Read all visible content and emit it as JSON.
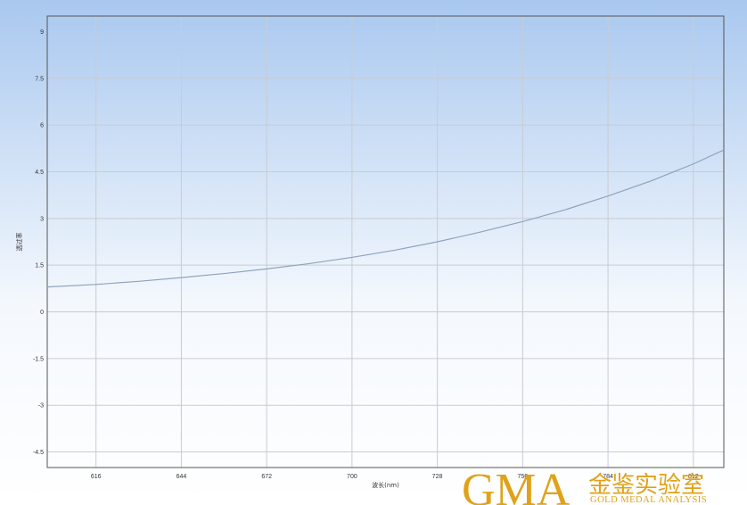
{
  "chart_data": {
    "type": "line",
    "title": "",
    "xlabel": "波长(nm)",
    "ylabel": "透过率",
    "xlim": [
      600,
      822
    ],
    "ylim": [
      -5,
      9.5
    ],
    "x_ticks": [
      "616",
      "644",
      "672",
      "700",
      "728",
      "756",
      "784",
      "812"
    ],
    "y_ticks": [
      "9",
      "7.5",
      "6",
      "4.5",
      "3",
      "1.5",
      "0",
      "-1.5",
      "-3",
      "-4.5"
    ],
    "grid": true,
    "series": [
      {
        "x": [
          600,
          616,
          630,
          644,
          658,
          672,
          686,
          700,
          714,
          728,
          742,
          756,
          770,
          784,
          798,
          812,
          822
        ],
        "y": [
          0.8,
          0.88,
          0.98,
          1.1,
          1.23,
          1.38,
          1.55,
          1.75,
          1.98,
          2.25,
          2.56,
          2.9,
          3.28,
          3.72,
          4.2,
          4.75,
          5.2
        ],
        "color": "#8fa3bd"
      }
    ]
  },
  "watermark": {
    "logo_text": "GMA",
    "chinese_text": "金鉴实验室",
    "english_text": "GOLD MEDAL ANALYSIS",
    "color": "#e0a21a"
  },
  "colors": {
    "background_top": "#a9c8ef",
    "background_bottom": "#ffffff",
    "grid": "#c8ccd2",
    "series": "#8fa3bd"
  }
}
